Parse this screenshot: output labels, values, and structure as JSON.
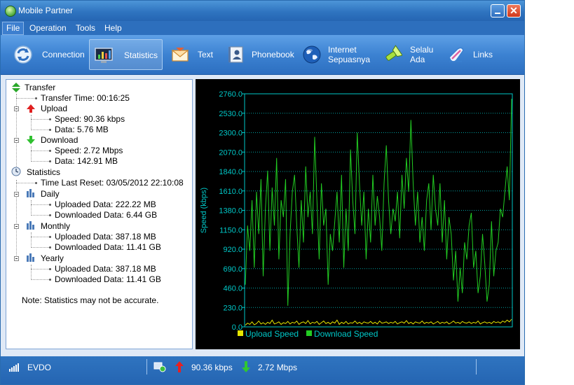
{
  "window": {
    "title": "Mobile Partner",
    "minimize_icon": "minimize-icon",
    "close_label": "✕"
  },
  "menu": {
    "items": [
      "File",
      "Operation",
      "Tools",
      "Help"
    ]
  },
  "toolbar": {
    "items": [
      {
        "label": "Connection",
        "icon": "connection-icon"
      },
      {
        "label": "Statistics",
        "icon": "statistics-icon",
        "selected": true
      },
      {
        "label": "Text",
        "icon": "envelope-icon"
      },
      {
        "label": "Phonebook",
        "icon": "phonebook-icon"
      },
      {
        "label_line1": "Internet",
        "label_line2": "Sepuasnya",
        "icon": "globe-icon"
      },
      {
        "label_line1": "Selalu",
        "label_line2": "Ada",
        "icon": "flashlight-icon"
      },
      {
        "label": "Links",
        "icon": "links-icon"
      }
    ]
  },
  "tree": {
    "transfer": {
      "label": "Transfer",
      "time": "Transfer Time: 00:16:25",
      "upload": {
        "label": "Upload",
        "speed": "Speed: 90.36 kbps",
        "data": "Data: 5.76 MB"
      },
      "download": {
        "label": "Download",
        "speed": "Speed: 2.72 Mbps",
        "data": "Data: 142.91 MB"
      }
    },
    "statistics": {
      "label": "Statistics",
      "last_reset": "Time Last Reset: 03/05/2012 22:10:08",
      "daily": {
        "label": "Daily",
        "uploaded": "Uploaded Data: 222.22 MB",
        "downloaded": "Downloaded Data: 6.44 GB"
      },
      "monthly": {
        "label": "Monthly",
        "uploaded": "Uploaded Data: 387.18 MB",
        "downloaded": "Downloaded Data: 11.41 GB"
      },
      "yearly": {
        "label": "Yearly",
        "uploaded": "Uploaded Data: 387.18 MB",
        "downloaded": "Downloaded Data: 11.41 GB"
      }
    },
    "note": "Note: Statistics may not be accurate."
  },
  "chart_data": {
    "type": "line",
    "ylabel": "Speed (kbps)",
    "ylim": [
      0,
      2760
    ],
    "yticks": [
      "2760.0",
      "2530.0",
      "2300.0",
      "2070.0",
      "1840.0",
      "1610.0",
      "1380.0",
      "1150.0",
      "920.0",
      "690.0",
      "460.0",
      "230.0",
      "0.0"
    ],
    "grid": true,
    "legend_position": "bottom",
    "colors": {
      "background": "#000000",
      "axis": "#00c8c8",
      "grid": "#00c8c8",
      "upload": "#e6e600",
      "download": "#22cc22"
    },
    "series": [
      {
        "name": "Upload Speed",
        "values": [
          20,
          45,
          30,
          60,
          25,
          40,
          70,
          35,
          50,
          30,
          55,
          40,
          80,
          35,
          45,
          60,
          30,
          50,
          40,
          65,
          35,
          55,
          45,
          70,
          30,
          50,
          60,
          40,
          75,
          35,
          55,
          45,
          65,
          30,
          50,
          70,
          40,
          55,
          35,
          60,
          45,
          80,
          30,
          55,
          40,
          65,
          35,
          50,
          45,
          70,
          40,
          55,
          35,
          60,
          50,
          45,
          65,
          40,
          55,
          35,
          70,
          45,
          50,
          60,
          40,
          55,
          45,
          65,
          35,
          50,
          60,
          45,
          75,
          40,
          55,
          35,
          60,
          50,
          45,
          70,
          40,
          55,
          45,
          60,
          35,
          50,
          65,
          40,
          55,
          45,
          60,
          35,
          50,
          70,
          45,
          55,
          40,
          65,
          50,
          45,
          60,
          40,
          55,
          45,
          70,
          35,
          50,
          60,
          45,
          55,
          40,
          65,
          50,
          60,
          45,
          70,
          55,
          80,
          60,
          90
        ]
      },
      {
        "name": "Download Speed",
        "values": [
          500,
          1200,
          900,
          1500,
          700,
          1600,
          1100,
          1750,
          600,
          1400,
          1850,
          900,
          1650,
          1200,
          2000,
          800,
          1500,
          1300,
          1750,
          250,
          1100,
          1600,
          1800,
          1200,
          700,
          1500,
          1000,
          1900,
          1300,
          1600,
          1100,
          2250,
          1500,
          800,
          1700,
          1200,
          1400,
          500,
          1100,
          900,
          1250,
          1600,
          1000,
          1800,
          700,
          1400,
          900,
          2100,
          1500,
          1100,
          2300,
          1700,
          1200,
          1600,
          800,
          1400,
          1000,
          1800,
          1200,
          1550,
          1300,
          900,
          1700,
          2150,
          1500,
          1100,
          1400,
          1250,
          1600,
          1050,
          1800,
          1400,
          2000,
          1600,
          2450,
          1700,
          1200,
          1600,
          1000,
          1300,
          900,
          1500,
          1700,
          1150,
          1800,
          1400,
          1200,
          1700,
          1000,
          1500,
          800,
          1300,
          1100,
          550,
          900,
          300,
          700,
          400,
          1000,
          800,
          1200,
          1350,
          700,
          900,
          400,
          600,
          1100,
          750,
          300,
          500,
          1250,
          600,
          900,
          1000,
          1400,
          1300,
          1600,
          1900,
          1500,
          2700
        ]
      }
    ]
  },
  "statusbar": {
    "network": "EVDO",
    "upload_speed": "90.36 kbps",
    "download_speed": "2.72 Mbps"
  }
}
